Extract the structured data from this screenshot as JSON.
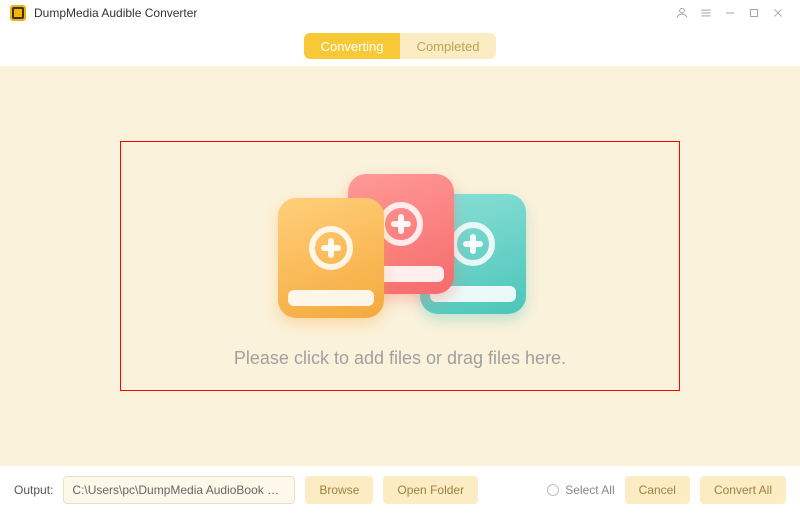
{
  "titlebar": {
    "app_name": "DumpMedia Audible Converter"
  },
  "tabs": {
    "converting": "Converting",
    "completed": "Completed"
  },
  "dropzone": {
    "hint": "Please click to add files or drag files here."
  },
  "footer": {
    "output_label": "Output:",
    "output_path": "C:\\Users\\pc\\DumpMedia AudioBook Converte",
    "browse": "Browse",
    "open_folder": "Open Folder",
    "select_all": "Select All",
    "cancel": "Cancel",
    "convert_all": "Convert All"
  }
}
